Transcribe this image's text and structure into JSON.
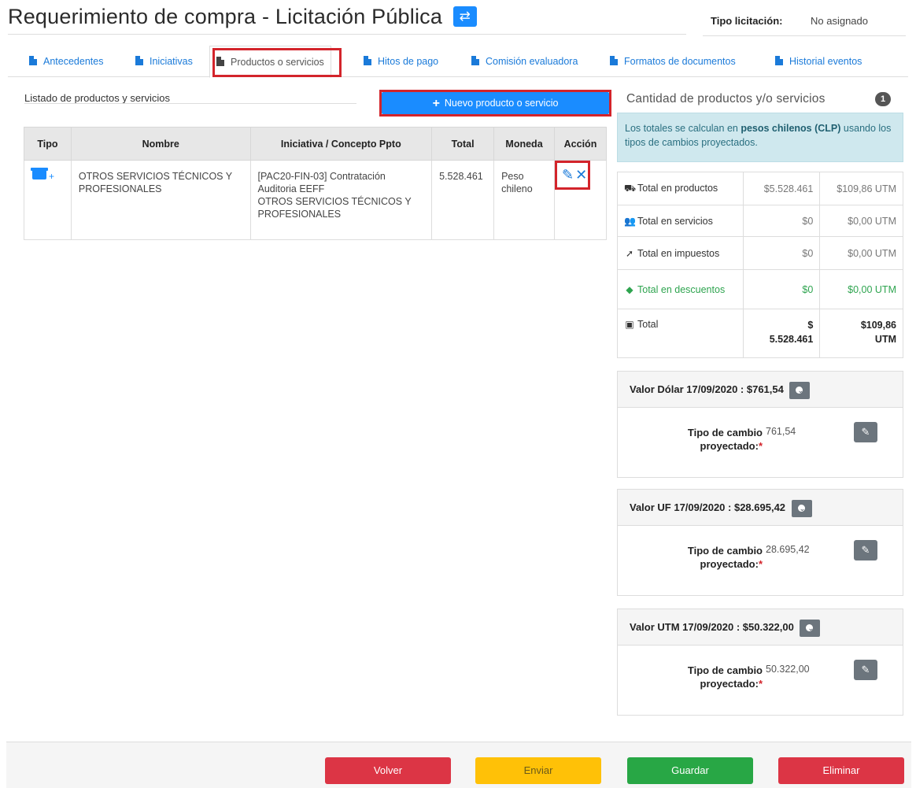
{
  "header": {
    "title": "Requerimiento de compra - Licitación Pública",
    "tipo_label": "Tipo licitación:",
    "tipo_value": "No asignado"
  },
  "tabs": [
    {
      "label": "Antecedentes",
      "active": false
    },
    {
      "label": "Iniciativas",
      "active": false
    },
    {
      "label": "Productos o servicios",
      "active": true
    },
    {
      "label": "Hitos de pago",
      "active": false
    },
    {
      "label": "Comisión evaluadora",
      "active": false
    },
    {
      "label": "Formatos de documentos",
      "active": false
    },
    {
      "label": "Historial eventos",
      "active": false
    }
  ],
  "products": {
    "section_title": "Listado de productos y servicios",
    "new_button": "Nuevo producto o servicio",
    "columns": [
      "Tipo",
      "Nombre",
      "Iniciativa / Concepto Ppto",
      "Total",
      "Moneda",
      "Acción"
    ],
    "rows": [
      {
        "tipo_icon": "box-icon",
        "nombre": "OTROS SERVICIOS TÉCNICOS Y PROFESIONALES",
        "iniciativa_line1": "[PAC20-FIN-03] Contratación Auditoria EEFF",
        "iniciativa_line2": "OTROS SERVICIOS TÉCNICOS Y PROFESIONALES",
        "total": "5.528.461",
        "moneda": "Peso chileno"
      }
    ]
  },
  "summary": {
    "title": "Cantidad de productos y/o servicios",
    "count": "1",
    "info_prefix": "Los totales se calculan en ",
    "info_bold": "pesos chilenos (CLP)",
    "info_suffix": " usando los tipos de cambios proyectados.",
    "rows": [
      {
        "icon": "truck-icon",
        "label": "Total en productos",
        "clp": "$5.528.461",
        "utm": "$109,86 UTM"
      },
      {
        "icon": "people-icon",
        "label": "Total en servicios",
        "clp": "$0",
        "utm": "$0,00 UTM"
      },
      {
        "icon": "gavel-icon",
        "label": "Total en impuestos",
        "clp": "$0",
        "utm": "$0,00 UTM"
      },
      {
        "icon": "tags-icon",
        "label": "Total en descuentos",
        "clp": "$0",
        "utm": "$0,00 UTM"
      },
      {
        "icon": "money-icon",
        "label": "Total",
        "clp_line1": "$",
        "clp_line2": "5.528.461",
        "utm_line1": "$109,86",
        "utm_line2": "UTM"
      }
    ]
  },
  "currencies": [
    {
      "header": "Valor Dólar 17/09/2020 : $761,54",
      "label_line1": "Tipo de cambio",
      "label_line2": "proyectado:",
      "value": "761,54"
    },
    {
      "header": "Valor UF 17/09/2020 : $28.695,42",
      "label_line1": "Tipo de cambio",
      "label_line2": "proyectado:",
      "value": "28.695,42"
    },
    {
      "header": "Valor UTM 17/09/2020 : $50.322,00",
      "label_line1": "Tipo de cambio",
      "label_line2": "proyectado:",
      "value": "50.322,00"
    }
  ],
  "footer": {
    "volver": "Volver",
    "enviar": "Enviar",
    "guardar": "Guardar",
    "eliminar": "Eliminar"
  },
  "colors": {
    "primary": "#1a8cff",
    "highlight": "#d3242b",
    "volver": "#dc3545",
    "enviar": "#ffc107",
    "guardar": "#28a745",
    "eliminar": "#dc3545",
    "info_bg": "#cfe8ee",
    "discount_green": "#2ea44f"
  }
}
